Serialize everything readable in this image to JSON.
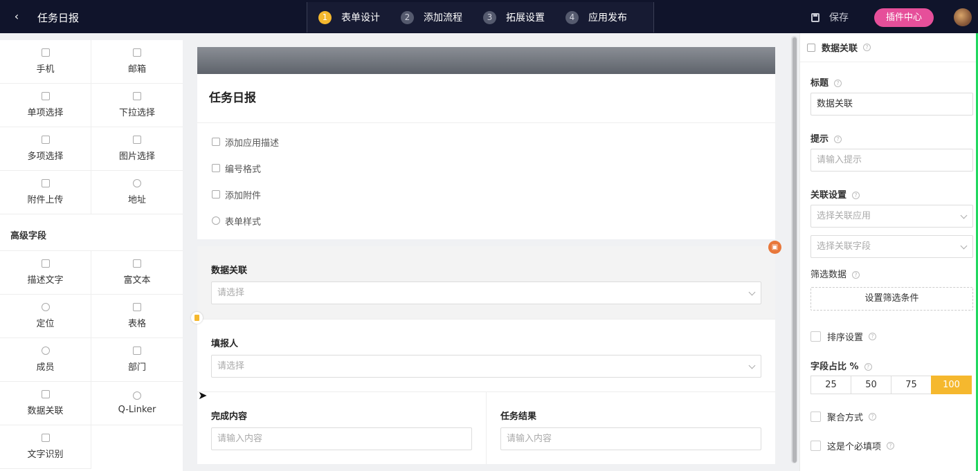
{
  "topbar": {
    "back_icon": "‹",
    "title": "任务日报",
    "steps": [
      {
        "num": "1",
        "label": "表单设计"
      },
      {
        "num": "2",
        "label": "添加流程"
      },
      {
        "num": "3",
        "label": "拓展设置"
      },
      {
        "num": "4",
        "label": "应用发布"
      }
    ],
    "save_label": "保存",
    "plugin_label": "插件中心"
  },
  "left_panel": {
    "basic_fields": [
      "手机",
      "邮箱",
      "单项选择",
      "下拉选择",
      "多项选择",
      "图片选择",
      "附件上传",
      "地址"
    ],
    "advanced_title": "高级字段",
    "advanced_fields": [
      "描述文字",
      "富文本",
      "定位",
      "表格",
      "成员",
      "部门",
      "数据关联",
      "Q-Linker",
      "文字识别"
    ]
  },
  "form": {
    "title": "任务日报",
    "options": [
      "添加应用描述",
      "编号格式",
      "添加附件",
      "表单样式"
    ],
    "fields": [
      {
        "label": "数据关联",
        "placeholder": "请选择"
      },
      {
        "label": "填报人",
        "placeholder": "请选择"
      },
      {
        "label": "完成内容",
        "placeholder": "请输入内容"
      },
      {
        "label": "任务结果",
        "placeholder": "请输入内容"
      }
    ]
  },
  "right_panel": {
    "head_title": "数据关联",
    "title_label": "标题",
    "title_value": "数据关联",
    "hint_label": "提示",
    "hint_placeholder": "请输入提示",
    "link_label": "关联设置",
    "link_app_placeholder": "选择关联应用",
    "link_field_placeholder": "选择关联字段",
    "filter_label": "筛选数据",
    "filter_button": "设置筛选条件",
    "sort_label": "排序设置",
    "ratio_label": "字段占比 %",
    "ratio_options": [
      "25",
      "50",
      "75",
      "100"
    ],
    "aggregate_label": "聚合方式",
    "required_label": "这是个必填项"
  },
  "colors": {
    "topbar_bg": "#10142b",
    "accent_yellow": "#f5b82e",
    "plugin_pink": "#e64f9a",
    "delete_orange": "#e8773a"
  }
}
